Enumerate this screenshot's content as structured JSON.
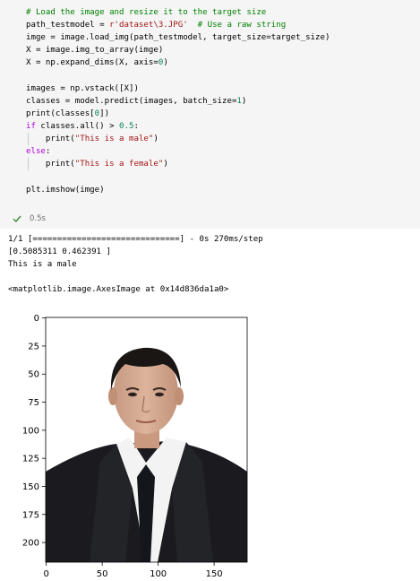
{
  "code_cell": {
    "lines": [
      {
        "segments": [
          {
            "text": "# Load the image and resize it to the target size",
            "kind": "comment"
          }
        ]
      },
      {
        "segments": [
          {
            "text": "path_testmodel = ",
            "kind": "plain"
          },
          {
            "text": "r'dataset\\3.JPG'",
            "kind": "string"
          },
          {
            "text": "  ",
            "kind": "plain"
          },
          {
            "text": "# Use a raw string",
            "kind": "comment"
          }
        ]
      },
      {
        "segments": [
          {
            "text": "imge = image.load_img(path_testmodel, target_size=target_size)",
            "kind": "plain"
          }
        ]
      },
      {
        "segments": [
          {
            "text": "X = image.img_to_array(imge)",
            "kind": "plain"
          }
        ]
      },
      {
        "segments": [
          {
            "text": "X = np.expand_dims(X, axis=",
            "kind": "plain"
          },
          {
            "text": "0",
            "kind": "number"
          },
          {
            "text": ")",
            "kind": "plain"
          }
        ]
      },
      {
        "segments": [
          {
            "text": "images = np.vstack([X])",
            "kind": "plain"
          }
        ]
      },
      {
        "segments": [
          {
            "text": "classes = model.predict(images, batch_size=",
            "kind": "plain"
          },
          {
            "text": "1",
            "kind": "number"
          },
          {
            "text": ")",
            "kind": "plain"
          }
        ]
      },
      {
        "segments": [
          {
            "text": "print",
            "kind": "builtin"
          },
          {
            "text": "(classes[",
            "kind": "plain"
          },
          {
            "text": "0",
            "kind": "number"
          },
          {
            "text": "])",
            "kind": "plain"
          }
        ]
      },
      {
        "segments": [
          {
            "text": "if",
            "kind": "keyword"
          },
          {
            "text": " classes.",
            "kind": "plain"
          },
          {
            "text": "all",
            "kind": "builtin"
          },
          {
            "text": "() > ",
            "kind": "plain"
          },
          {
            "text": "0.5",
            "kind": "number"
          },
          {
            "text": ":",
            "kind": "plain"
          }
        ]
      },
      {
        "segments": [
          {
            "text": "    ",
            "kind": "plain"
          },
          {
            "text": "print",
            "kind": "builtin"
          },
          {
            "text": "(",
            "kind": "plain"
          },
          {
            "text": "\"This is a male\"",
            "kind": "string"
          },
          {
            "text": ")",
            "kind": "plain"
          }
        ]
      },
      {
        "segments": [
          {
            "text": "else",
            "kind": "keyword"
          },
          {
            "text": ":",
            "kind": "plain"
          }
        ]
      },
      {
        "segments": [
          {
            "text": "    ",
            "kind": "plain"
          },
          {
            "text": "print",
            "kind": "builtin"
          },
          {
            "text": "(",
            "kind": "plain"
          },
          {
            "text": "\"This is a female\"",
            "kind": "string"
          },
          {
            "text": ")",
            "kind": "plain"
          }
        ]
      },
      {
        "segments": [
          {
            "text": "plt.imshow(imge)",
            "kind": "plain"
          }
        ]
      }
    ],
    "status": {
      "icon": "check-icon",
      "time": "0.5s"
    }
  },
  "output": {
    "lines": [
      "1/1 [==============================] - 0s 270ms/step",
      "[0.5085311 0.462391 ]",
      "This is a male",
      "<matplotlib.image.AxesImage at 0x14d836da1a0>"
    ]
  },
  "plot": {
    "y_ticks": [
      "0",
      "25",
      "50",
      "75",
      "100",
      "125",
      "150",
      "175",
      "200"
    ],
    "x_ticks": [
      "0",
      "50",
      "100",
      "150"
    ],
    "image_size": [
      180,
      218
    ],
    "image": "portrait photo of a man in a dark suit, white shirt and dark tie"
  },
  "colors": {
    "cell_background": "#f5f5f5",
    "comment": "#008000",
    "string": "#a31515",
    "number": "#098658",
    "keyword": "#af00db",
    "status_check": "#388a34"
  }
}
